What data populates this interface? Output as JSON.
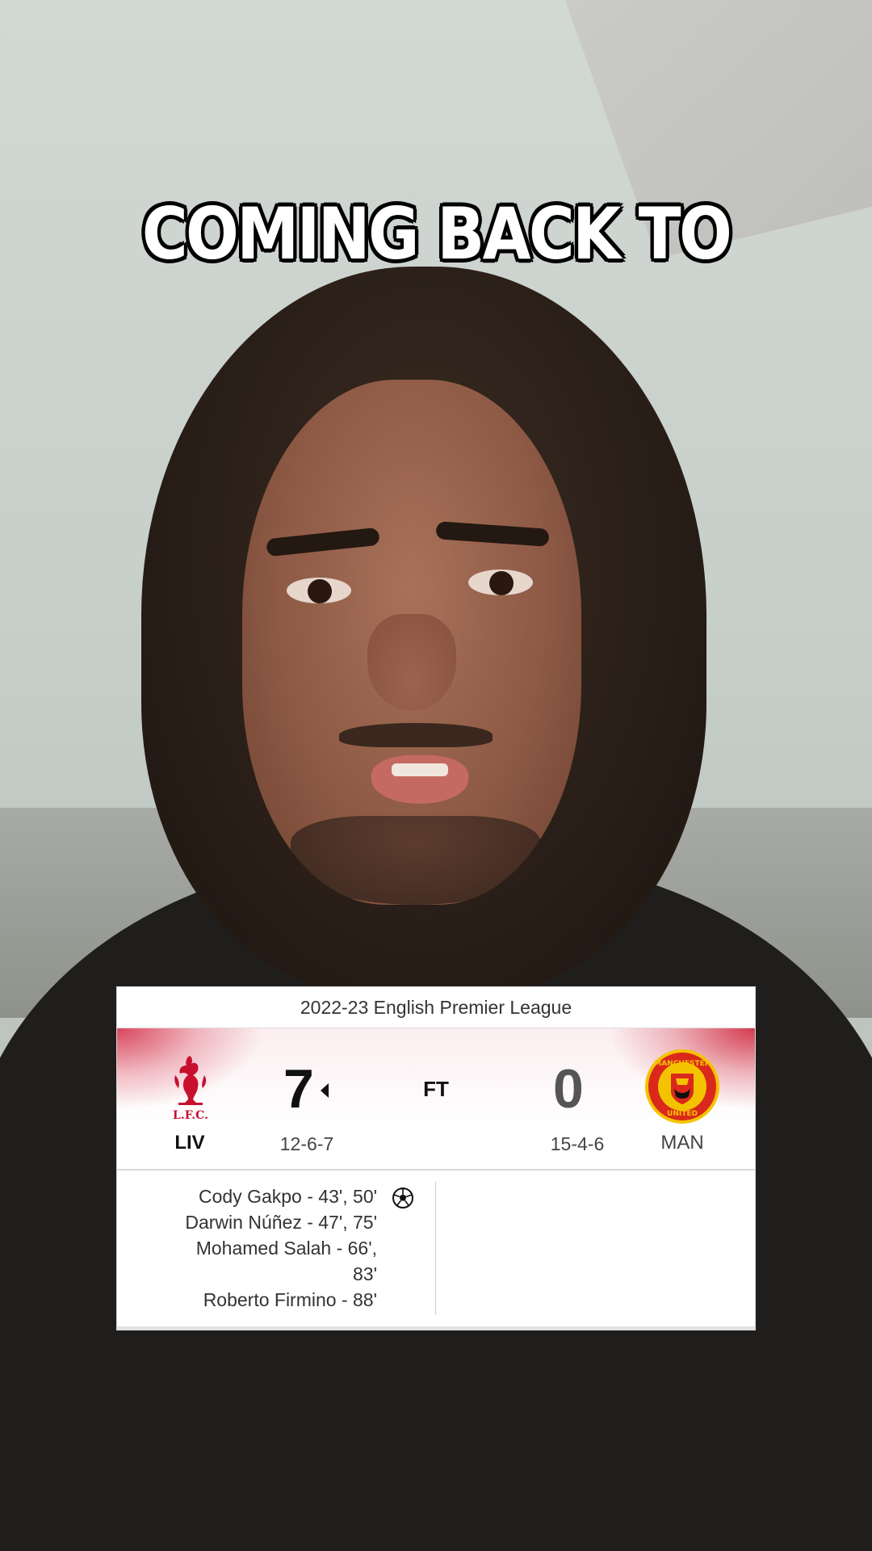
{
  "caption": {
    "text": "COMING BACK TO"
  },
  "scorecard": {
    "competition": "2022-23 English Premier League",
    "status": "FT",
    "home": {
      "abbr": "LIV",
      "crest_text": "L.F.C.",
      "score": "7",
      "record": "12-6-7",
      "color": "#c8102e"
    },
    "away": {
      "abbr": "MAN",
      "crest_top": "MANCHESTER",
      "crest_bottom": "UNITED",
      "score": "0",
      "record": "15-4-6",
      "color": "#da291c"
    },
    "home_scorers": [
      "Cody Gakpo - 43', 50'",
      "Darwin Núñez - 47', 75'",
      "Mohamed Salah - 66',",
      "83'",
      "Roberto Firmino - 88'"
    ],
    "icons": {
      "goal": "soccer-ball-icon",
      "possession": "caret-left-icon"
    }
  }
}
